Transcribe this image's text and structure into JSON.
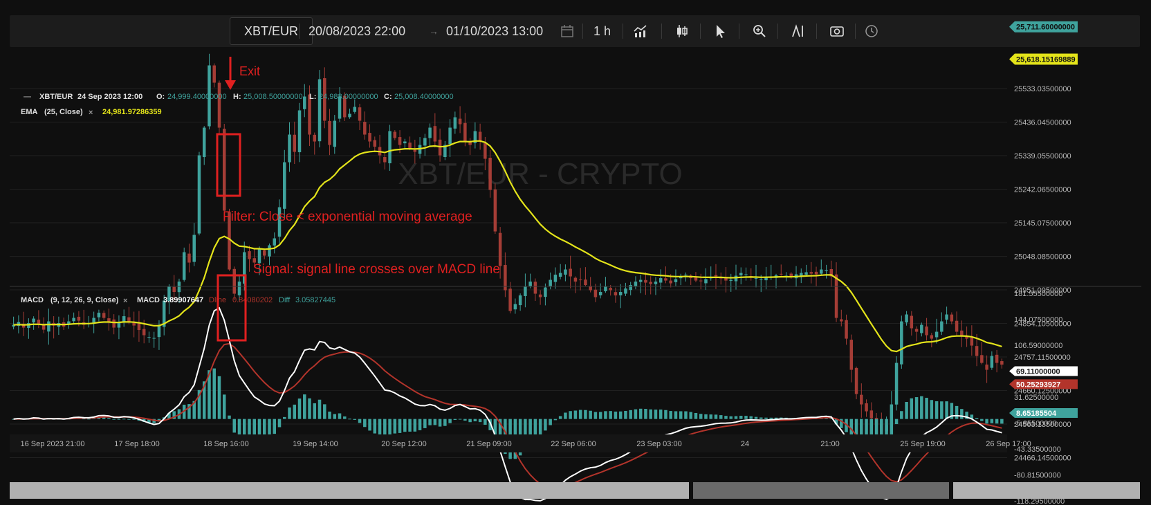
{
  "toolbar": {
    "symbol": "XBT/EUR",
    "date_from": "20/08/2023 22:00",
    "date_arrow": "→",
    "date_to": "01/10/2023 13:00",
    "interval": "1 h",
    "icons": [
      "calendar-icon",
      "chart-type-icon",
      "candlestick-icon",
      "cursor-icon",
      "zoom-icon",
      "indicators-icon",
      "screenshot-icon",
      "clock-icon"
    ]
  },
  "watermark": "XBT/EUR - CRYPTO",
  "legend": {
    "symbol_line": {
      "dash": "—",
      "symbol": "XBT/EUR",
      "datetime": "24 Sep 2023 12:00",
      "o_label": "O:",
      "o_value": "24,999.40000000",
      "h_label": "H:",
      "h_value": "25,008.50000000",
      "l_label": "L:",
      "l_value": "24,988.00000000",
      "c_label": "C:",
      "c_value": "25,008.40000000"
    },
    "ema_line": {
      "name": "EMA",
      "params": "(25, Close)",
      "close_icon": "×",
      "value": "24,981.97286359"
    },
    "macd_line": {
      "name": "MACD",
      "params": "(9, 12, 26, 9, Close)",
      "close_icon": "×",
      "macd_label": "MACD",
      "macd_value": "3.89907647",
      "signal_label": "Dline",
      "signal_value": "0.84080202",
      "diff_label": "Diff",
      "diff_value": "3.05827445"
    }
  },
  "annotations": {
    "exit": "Exit",
    "filter": "Filter: Close < exponential moving average",
    "signal": "Signal: signal line crosses over MACD line"
  },
  "colors": {
    "bg": "#0f0f0f",
    "up": "#3fa39d",
    "down": "#a53d36",
    "ema": "#e4e41a",
    "macd": "#ffffff",
    "signal": "#b3342b",
    "annotation": "#e02020",
    "grid": "#202020",
    "axis_text": "#b8b8b8"
  },
  "chart_data": [
    {
      "type": "candlestick",
      "title": "XBT/EUR",
      "y_ticks": [
        25533.035,
        25436.045,
        25339.055,
        25242.065,
        25145.075,
        25048.085,
        24951.095,
        24854.105,
        24757.115,
        24660.125,
        24563.135,
        24466.145
      ],
      "y_tick_labels": [
        "25533.03500000",
        "25436.04500000",
        "25339.05500000",
        "25242.06500000",
        "25145.07500000",
        "25048.08500000",
        "24951.09500000",
        "24854.10500000",
        "24757.11500000",
        "24660.12500000",
        "24563.13500000",
        "24466.14500000"
      ],
      "price_tags": [
        {
          "label": "25,711.60000000",
          "value": 25711.6,
          "color": "#3fa39d"
        },
        {
          "label": "25,618.15169889",
          "value": 25618.15,
          "color": "#e4e41a"
        }
      ],
      "x_tick_labels": [
        "16 Sep 2023 21:00",
        "17 Sep 18:00",
        "18 Sep 16:00",
        "19 Sep 14:00",
        "20 Sep 12:00",
        "21 Sep 09:00",
        "22 Sep 06:00",
        "23 Sep 03:00",
        "24",
        "21:00",
        "25 Sep 19:00",
        "26 Sep 17:00"
      ],
      "ema_period": 25,
      "close_path": [
        24850,
        24858,
        24842,
        24855,
        24868,
        24850,
        24836,
        24860,
        24848,
        24855,
        24845,
        24860,
        24870,
        24862,
        24850,
        24855,
        24870,
        24885,
        24870,
        24860,
        24842,
        24858,
        24875,
        24860,
        24848,
        24835,
        24820,
        24815,
        24812,
        24850,
        24920,
        24960,
        24945,
        24975,
        25060,
        25030,
        25110,
        25340,
        25420,
        25600,
        25550,
        25420,
        25180,
        25010,
        24940,
        24975,
        25060,
        25040,
        25030,
        25070,
        25050,
        25080,
        25100,
        25190,
        25320,
        25400,
        25350,
        25470,
        25510,
        25400,
        25380,
        25560,
        25440,
        25370,
        25440,
        25510,
        25450,
        25460,
        25480,
        25440,
        25400,
        25380,
        25365,
        25340,
        25320,
        25410,
        25390,
        25370,
        25380,
        25360,
        25350,
        25370,
        25390,
        25420,
        25380,
        25340,
        25370,
        25420,
        25450,
        25430,
        25380,
        25370,
        25410,
        25380,
        25330,
        25240,
        25120,
        25020,
        24950,
        24890,
        24910,
        24935,
        24960,
        24975,
        24940,
        24930,
        24958,
        24980,
        24995,
        25000,
        25010,
        24990,
        24975,
        24980,
        24965,
        24950,
        24930,
        24945,
        24960,
        24950,
        24935,
        24945,
        24955,
        24965,
        24975,
        24980,
        24972,
        24968,
        24975,
        24985,
        24978,
        24970,
        24982,
        24990,
        24995,
        24985,
        24978,
        24976,
        24982,
        24988,
        24990,
        24984,
        24978,
        24980,
        24992,
        25000,
        24996,
        24990,
        24985,
        24982,
        24988,
        24990,
        24993,
        24996,
        24992,
        24988,
        24996,
        25000,
        25002,
        24998,
        24996,
        25010,
        25008,
        24990,
        24870,
        24860,
        24810,
        24720,
        24650,
        24620,
        24600,
        24580,
        24560,
        24540,
        24560,
        24620,
        24740,
        24860,
        24880,
        24840,
        24830,
        24850,
        24820,
        24810,
        24830,
        24860,
        24880,
        24860,
        24830,
        24820,
        24810,
        24790,
        24760,
        24740,
        24720,
        24760,
        24740,
        24735
      ],
      "macd_y_ticks": [
        181.555,
        144.075,
        106.59,
        69.11,
        31.625,
        -5.855,
        -43.335,
        -80.815,
        -118.295
      ],
      "macd_y_tick_labels": [
        "181.55500000",
        "144.07500000",
        "106.59000000",
        "69.11000000",
        "31.62500000",
        "-5.85500000",
        "-43.33500000",
        "-80.81500000",
        "-118.29500000"
      ],
      "macd_tags": [
        {
          "label": "69.11000000",
          "value": 69.11,
          "color": "#ffffff"
        },
        {
          "label": "50.25293927",
          "value": 50.25,
          "color": "#b3342b"
        },
        {
          "label": "8.65185504",
          "value": 8.65,
          "color": "#3fa39d"
        }
      ],
      "macd_params": {
        "fast": 12,
        "slow": 26,
        "signal": 9
      }
    }
  ]
}
